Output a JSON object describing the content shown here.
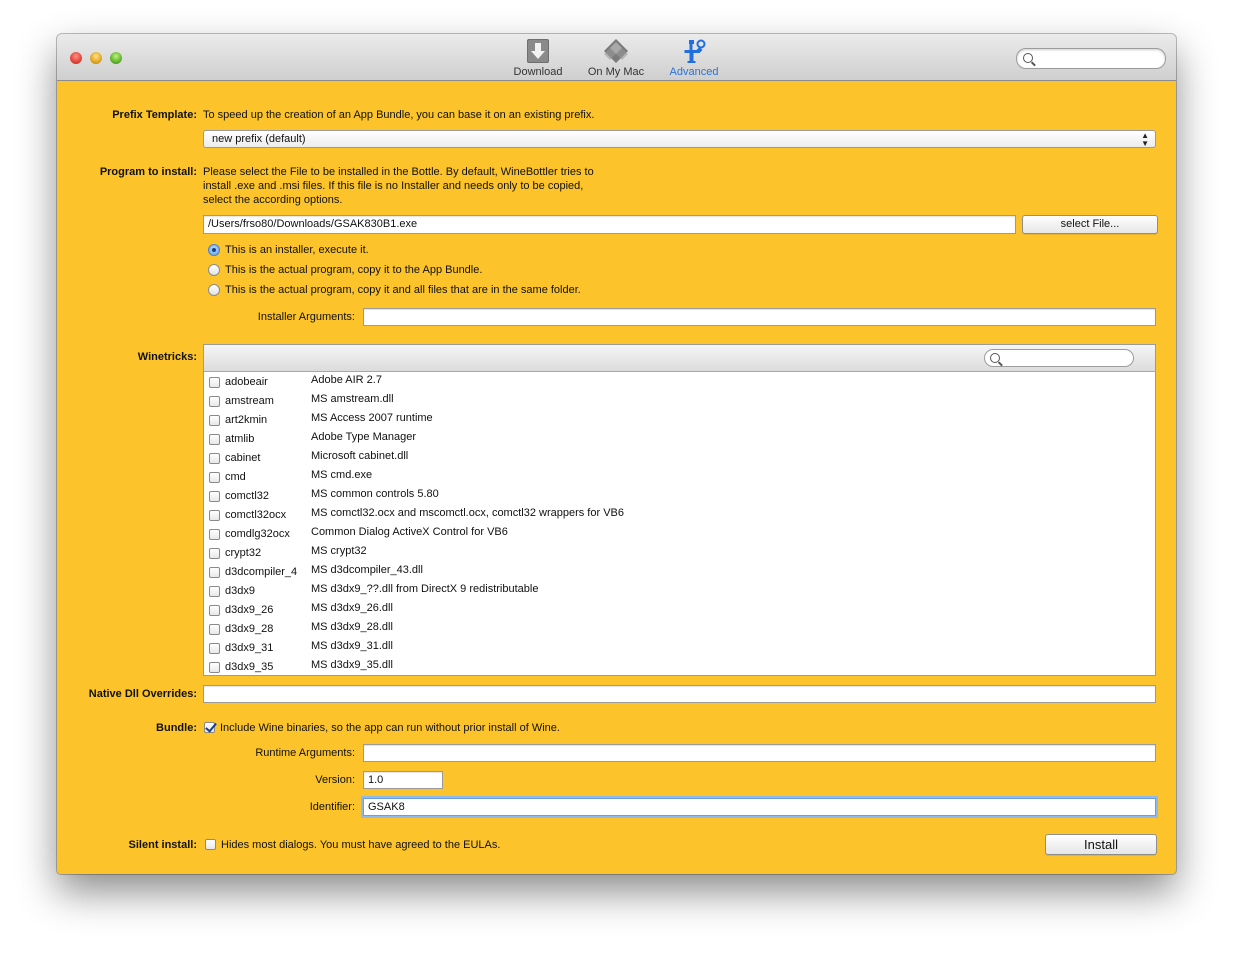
{
  "toolbar": {
    "items": [
      {
        "label": "Download",
        "icon": "download-icon"
      },
      {
        "label": "On My Mac",
        "icon": "mac-icon"
      },
      {
        "label": "Advanced",
        "icon": "advanced-icon"
      }
    ],
    "search_value": ""
  },
  "prefix": {
    "label": "Prefix Template:",
    "description": "To speed up the creation of an App Bundle, you can base it on an existing prefix.",
    "selected": "new prefix (default)"
  },
  "program": {
    "label": "Program to install:",
    "description_lines": [
      "Please select the File to be installed in the Bottle. By default, WineBottler tries to",
      "install .exe and .msi files. If this file is no Installer and needs only to be copied,",
      "select the according options."
    ],
    "path": "/Users/frso80/Downloads/GSAK830B1.exe",
    "select_button": "select File...",
    "options": [
      {
        "label": "This is an installer, execute it.",
        "selected": true
      },
      {
        "label": "This is the actual program, copy it to the App Bundle.",
        "selected": false
      },
      {
        "label": "This is the actual program, copy it and all files that are in the same folder.",
        "selected": false
      }
    ],
    "installer_args_label": "Installer Arguments:",
    "installer_args_value": ""
  },
  "winetricks": {
    "label": "Winetricks:",
    "search_value": "",
    "rows": [
      {
        "name": "adobeair",
        "desc": "Adobe AIR 2.7"
      },
      {
        "name": "amstream",
        "desc": "MS amstream.dll"
      },
      {
        "name": "art2kmin",
        "desc": "MS Access 2007 runtime"
      },
      {
        "name": "atmlib",
        "desc": "Adobe Type Manager"
      },
      {
        "name": "cabinet",
        "desc": "Microsoft cabinet.dll"
      },
      {
        "name": "cmd",
        "desc": "MS cmd.exe"
      },
      {
        "name": "comctl32",
        "desc": "MS common controls 5.80"
      },
      {
        "name": "comctl32ocx",
        "desc": "MS comctl32.ocx and mscomctl.ocx, comctl32 wrappers for VB6"
      },
      {
        "name": "comdlg32ocx",
        "desc": "Common Dialog ActiveX Control for VB6"
      },
      {
        "name": "crypt32",
        "desc": "MS crypt32"
      },
      {
        "name": "d3dcompiler_4",
        "desc": "MS d3dcompiler_43.dll"
      },
      {
        "name": "d3dx9",
        "desc": "MS d3dx9_??.dll from DirectX 9 redistributable"
      },
      {
        "name": "d3dx9_26",
        "desc": "MS d3dx9_26.dll"
      },
      {
        "name": "d3dx9_28",
        "desc": "MS d3dx9_28.dll"
      },
      {
        "name": "d3dx9_31",
        "desc": "MS d3dx9_31.dll"
      },
      {
        "name": "d3dx9_35",
        "desc": "MS d3dx9_35.dll"
      }
    ]
  },
  "native": {
    "label": "Native Dll Overrides:",
    "value": ""
  },
  "bundle": {
    "label": "Bundle:",
    "include_wine_label": "Include Wine binaries, so the app can run without prior install of Wine.",
    "include_wine_checked": true,
    "runtime_args_label": "Runtime Arguments:",
    "runtime_args_value": "",
    "version_label": "Version:",
    "version_value": "1.0",
    "identifier_label": "Identifier:",
    "identifier_value": "GSAK8"
  },
  "silent": {
    "label": "Silent install:",
    "text": "Hides most dialogs. You must have agreed to the EULAs.",
    "checked": false
  },
  "install_button": "Install"
}
